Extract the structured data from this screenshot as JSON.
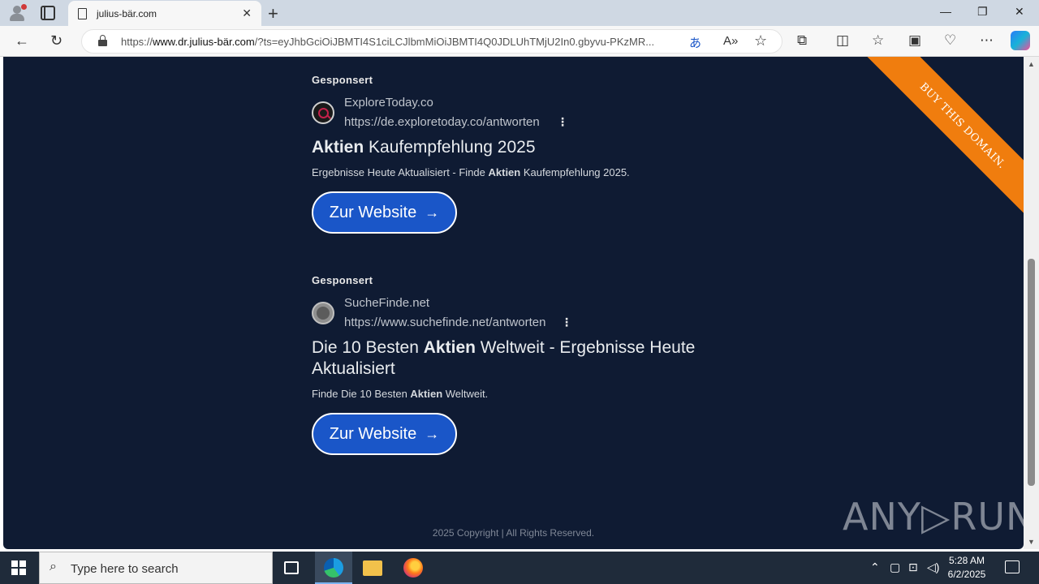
{
  "browser": {
    "tab_title": "julius-bär.com",
    "tab_close": "✕",
    "new_tab": "+",
    "url_prefix": "https://",
    "url_host": "www.dr.julius-bär.com",
    "url_rest": "/?ts=eyJhbGciOiJBMTI4S1ciLCJlbmMiOiJBMTI4Q0JDLUhTMjU2In0.gbyvu-PKzMR...",
    "window_controls": {
      "minimize": "—",
      "restore": "❐",
      "close": "✕"
    }
  },
  "page": {
    "ribbon_text": "BUY THIS DOMAIN.",
    "ads": [
      {
        "label": "Gesponsert",
        "site": "ExploreToday.co",
        "url": "https://de.exploretoday.co/antworten",
        "title_bold": "Aktien",
        "title_rest": " Kaufempfehlung 2025",
        "desc_pre": "Ergebnisse Heute Aktualisiert - Finde ",
        "desc_bold": "Aktien",
        "desc_post": " Kaufempfehlung 2025.",
        "cta": "Zur Website"
      },
      {
        "label": "Gesponsert",
        "site": "SucheFinde.net",
        "url": "https://www.suchefinde.net/antworten",
        "title_pre": "Die 10 Besten ",
        "title_bold": "Aktien",
        "title_rest": " Weltweit - Ergebnisse Heute Aktualisiert",
        "desc_pre": "Finde Die 10 Besten ",
        "desc_bold": "Aktien",
        "desc_post": " Weltweit.",
        "cta": "Zur Website"
      }
    ],
    "copyright": "2025 Copyright | All Rights Reserved.",
    "watermark": "ANY▷RUN"
  },
  "taskbar": {
    "search_placeholder": "Type here to search",
    "time": "5:28 AM",
    "date": "6/2/2025"
  }
}
